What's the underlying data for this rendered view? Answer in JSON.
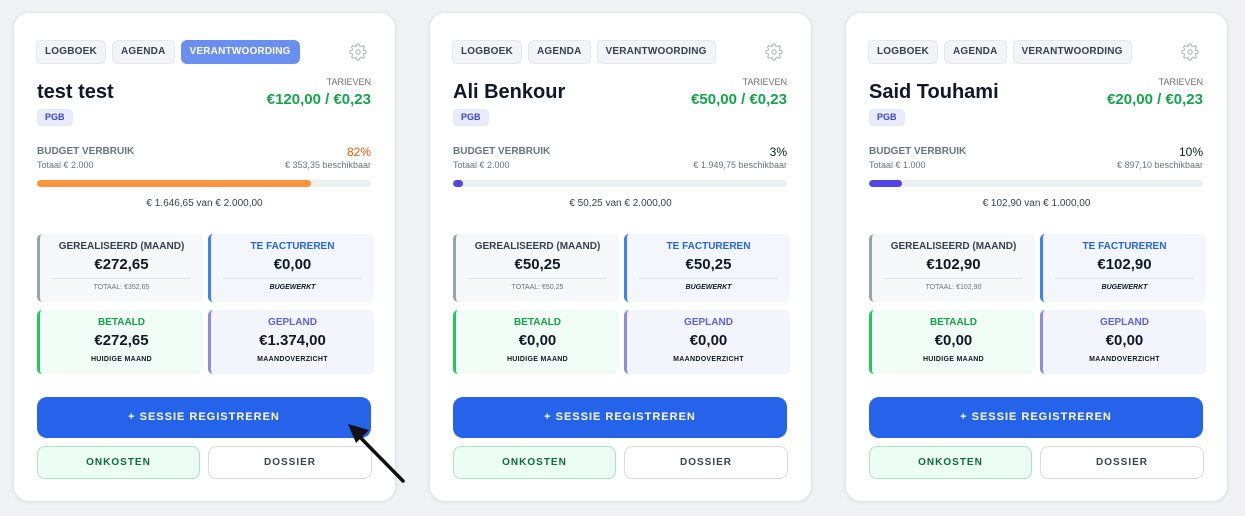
{
  "tabs": [
    "LOGBOEK",
    "AGENDA",
    "VERANTWOORDING"
  ],
  "labels": {
    "tarieven": "TARIEVEN",
    "budget_verbruik": "BUDGET VERBRUIK",
    "gerealiseerd": "GEREALISEERD (MAAND)",
    "te_factureren": "TE FACTUREREN",
    "bugewerkt": "BUGEWERKT",
    "betaald": "BETAALD",
    "huidige_maand": "HUIDIGE MAAND",
    "gepland": "GEPLAND",
    "maandoverzicht": "MAANDOVERZICHT",
    "sessie_registreren": "+ SESSIE REGISTREREN",
    "onkosten": "ONKOSTEN",
    "dossier": "DOSSIER"
  },
  "colors": {
    "accent_blue": "#2563eb",
    "tarief_green": "#16a34a",
    "gerealiseerd_border": "#9ca3af",
    "factureren_border": "#3b82f6",
    "betaald_border": "#22c55e",
    "gepland_border": "#8b8fe0",
    "progress_orange": "#fb923c",
    "progress_indigo": "#4f46e5",
    "pct_orange": "#ea580c"
  },
  "icons": {
    "settings": "gear-icon",
    "pointer": "cursor-arrow-icon"
  },
  "clients": [
    {
      "name": "test test",
      "badge": "PGB",
      "tarieven": "€120,00 / €0,23",
      "budget_total": "Totaal € 2.000",
      "budget_pct": "82%",
      "budget_fraction": 0.82,
      "budget_pct_highlight": true,
      "budget_available": "€ 353,35 beschikbaar",
      "budget_used": "€ 1.646,65 van € 2.000,00",
      "gerealiseerd": "€272,65",
      "gerealiseerd_totaal": "TOTAAL: €352,65",
      "te_factureren": "€0,00",
      "betaald": "€272,65",
      "gepland": "€1.374,00",
      "active_tab": 2
    },
    {
      "name": "Ali Benkour",
      "badge": "PGB",
      "tarieven": "€50,00 / €0,23",
      "budget_total": "Totaal € 2.000",
      "budget_pct": "3%",
      "budget_fraction": 0.03,
      "budget_pct_highlight": false,
      "budget_available": "€ 1.949,75 beschikbaar",
      "budget_used": "€ 50,25 van € 2.000,00",
      "gerealiseerd": "€50,25",
      "gerealiseerd_totaal": "TOTAAL: €50,25",
      "te_factureren": "€50,25",
      "betaald": "€0,00",
      "gepland": "€0,00",
      "active_tab": -1
    },
    {
      "name": "Said Touhami",
      "badge": "PGB",
      "tarieven": "€20,00 / €0,23",
      "budget_total": "Totaal € 1.000",
      "budget_pct": "10%",
      "budget_fraction": 0.1,
      "budget_pct_highlight": false,
      "budget_available": "€ 897,10 beschikbaar",
      "budget_used": "€ 102,90 van € 1.000,00",
      "gerealiseerd": "€102,90",
      "gerealiseerd_totaal": "TOTAAL: €102,90",
      "te_factureren": "€102,90",
      "betaald": "€0,00",
      "gepland": "€0,00",
      "active_tab": -1
    }
  ]
}
